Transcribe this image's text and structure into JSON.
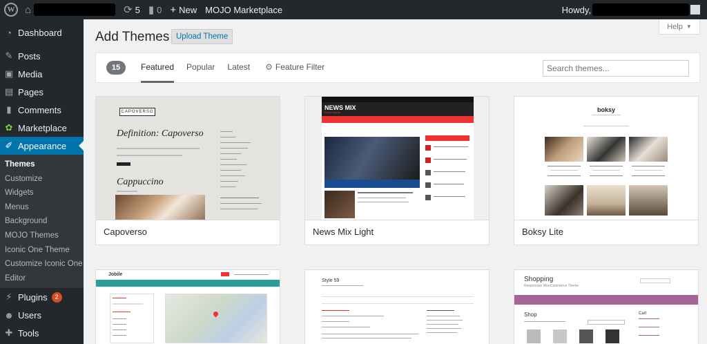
{
  "adminbar": {
    "logo": "W",
    "comment_count": "0",
    "updates_count": "5",
    "new_label": "New",
    "marketplace_label": "MOJO Marketplace",
    "howdy_label": "Howdy,"
  },
  "sidebar": {
    "items": [
      {
        "label": "Dashboard",
        "icon": "dashboard-icon"
      },
      {
        "label": "Posts",
        "icon": "pin-icon"
      },
      {
        "label": "Media",
        "icon": "media-icon"
      },
      {
        "label": "Pages",
        "icon": "pages-icon"
      },
      {
        "label": "Comments",
        "icon": "comment-icon"
      },
      {
        "label": "Marketplace",
        "icon": "marketplace-icon"
      },
      {
        "label": "Appearance",
        "icon": "brush-icon"
      }
    ],
    "submenu": [
      "Themes",
      "Customize",
      "Widgets",
      "Menus",
      "Background",
      "MOJO Themes",
      "Iconic One Theme",
      "Customize Iconic One",
      "Editor"
    ],
    "after": [
      {
        "label": "Plugins",
        "icon": "plugin-icon",
        "badge": "2"
      },
      {
        "label": "Users",
        "icon": "users-icon"
      },
      {
        "label": "Tools",
        "icon": "tools-icon"
      }
    ]
  },
  "main": {
    "title": "Add Themes",
    "upload_label": "Upload Theme",
    "help_label": "Help",
    "count": "15",
    "tabs": [
      "Featured",
      "Popular",
      "Latest"
    ],
    "feature_filter": "Feature Filter",
    "search_placeholder": "Search themes..."
  },
  "themes": [
    {
      "name": "Capoverso"
    },
    {
      "name": "News Mix Light"
    },
    {
      "name": "Boksy Lite"
    },
    {
      "name": ""
    },
    {
      "name": ""
    },
    {
      "name": ""
    }
  ],
  "thumb_text": {
    "capo_logo": "CAPOVERSO",
    "capo_h1": "Definition: Capoverso",
    "capo_h2": "Cappuccino",
    "news_logo": "NEWS MIX",
    "news_sub": "Demo theme",
    "boksy_logo": "boksy",
    "jobile_logo": "Jobile",
    "style_title": "Style 59",
    "shop_title": "Shopping",
    "shop_sub": "Responsive WooCommerce Theme",
    "shop_heading": "Shop",
    "shop_cart": "Cart"
  }
}
